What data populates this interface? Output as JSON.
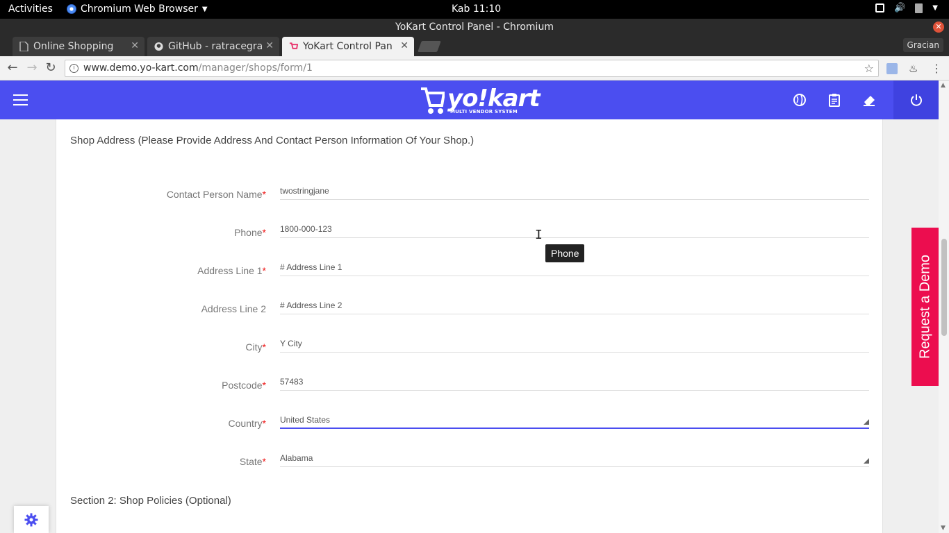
{
  "gnome": {
    "activities": "Activities",
    "app_name": "Chromium Web Browser",
    "clock": "Kab 11:10"
  },
  "window": {
    "title": "YoKart Control Panel - Chromium",
    "profile": "Gracian"
  },
  "tabs": [
    {
      "label": "Online Shopping",
      "icon": "page-icon"
    },
    {
      "label": "GitHub - ratracegra",
      "icon": "github-icon"
    },
    {
      "label": "YoKart Control Pan",
      "icon": "yokart-cart-icon",
      "active": true
    }
  ],
  "toolbar": {
    "url_host": "www.demo.yo-kart.com",
    "url_path": "/manager/shops/form/1"
  },
  "header": {
    "logo_word": "yo!kart",
    "logo_tag": "MULTI VENDOR SYSTEM",
    "icons": [
      "globe-icon",
      "clipboard-icon",
      "eraser-icon",
      "power-icon"
    ],
    "brand_color": "#4b4ef0"
  },
  "form": {
    "section_title": "Shop Address (Please Provide Address And Contact Person Information Of Your Shop.)",
    "fields": [
      {
        "label": "Contact Person Name",
        "required": true,
        "value": "twostringjane"
      },
      {
        "label": "Phone",
        "required": true,
        "value": "1800-000-123"
      },
      {
        "label": "Address Line 1",
        "required": true,
        "value": "# Address Line 1"
      },
      {
        "label": "Address Line 2",
        "required": false,
        "value": "# Address Line 2"
      },
      {
        "label": "City",
        "required": true,
        "value": "Y City"
      },
      {
        "label": "Postcode",
        "required": true,
        "value": "57483"
      },
      {
        "label": "Country",
        "required": true,
        "value": "United States"
      },
      {
        "label": "State",
        "required": true,
        "value": "Alabama"
      }
    ],
    "required_mark": "*",
    "section2_title": "Section 2: Shop Policies (Optional)"
  },
  "tooltip": "Phone",
  "demo_button": "Request a Demo",
  "colors": {
    "demo": "#ec0d4f",
    "required": "#e11"
  }
}
